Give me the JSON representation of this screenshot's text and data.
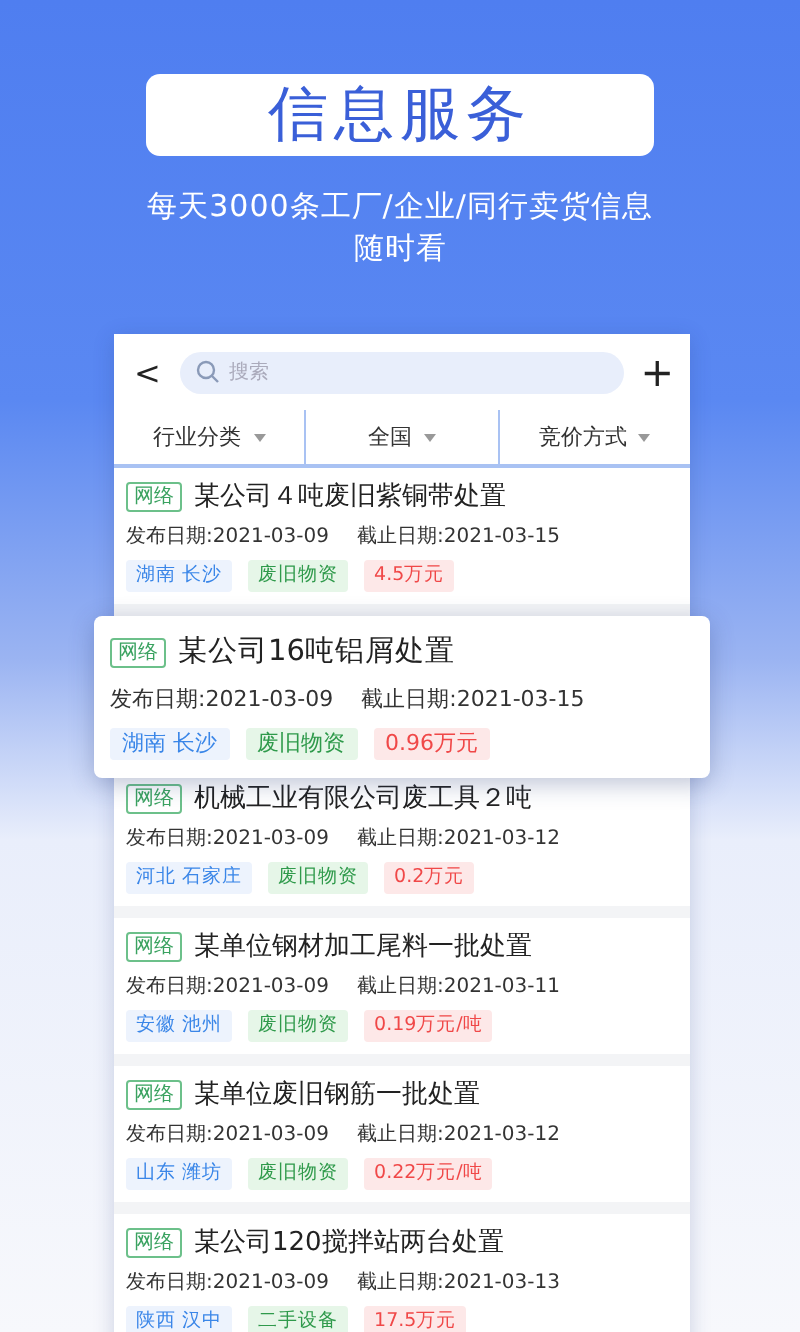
{
  "banner": {
    "title": "信息服务",
    "subtitle_lines": [
      "每天3000条工厂/企业/同行卖货信息",
      "随时看"
    ]
  },
  "toolbar": {
    "back": "<",
    "search_placeholder": "搜索",
    "add": "+"
  },
  "filters": [
    {
      "label": "行业分类"
    },
    {
      "label": "全国"
    },
    {
      "label": "竞价方式"
    }
  ],
  "listings": [
    {
      "source": "网络",
      "title": "某公司４吨废旧紫铜带处置",
      "publish": "发布日期:2021-03-09",
      "deadline": "截止日期:2021-03-15",
      "location": "湖南 长沙",
      "category": "废旧物资",
      "price": "4.5万元",
      "highlighted": false
    },
    {
      "source": "网络",
      "title": "某公司16吨铝屑处置",
      "publish": "发布日期:2021-03-09",
      "deadline": "截止日期:2021-03-15",
      "location": "湖南 长沙",
      "category": "废旧物资",
      "price": "0.96万元",
      "highlighted": true
    },
    {
      "source": "网络",
      "title": "机械工业有限公司废工具２吨",
      "publish": "发布日期:2021-03-09",
      "deadline": "截止日期:2021-03-12",
      "location": "河北 石家庄",
      "category": "废旧物资",
      "price": "0.2万元",
      "highlighted": false
    },
    {
      "source": "网络",
      "title": "某单位钢材加工尾料一批处置",
      "publish": "发布日期:2021-03-09",
      "deadline": "截止日期:2021-03-11",
      "location": "安徽 池州",
      "category": "废旧物资",
      "price": "0.19万元/吨",
      "highlighted": false
    },
    {
      "source": "网络",
      "title": "某单位废旧钢筋一批处置",
      "publish": "发布日期:2021-03-09",
      "deadline": "截止日期:2021-03-12",
      "location": "山东 潍坊",
      "category": "废旧物资",
      "price": "0.22万元/吨",
      "highlighted": false
    },
    {
      "source": "网络",
      "title": "某公司120搅拌站两台处置",
      "publish": "发布日期:2021-03-09",
      "deadline": "截止日期:2021-03-13",
      "location": "陕西 汉中",
      "category": "二手设备",
      "price": "17.5万元",
      "highlighted": false
    }
  ]
}
